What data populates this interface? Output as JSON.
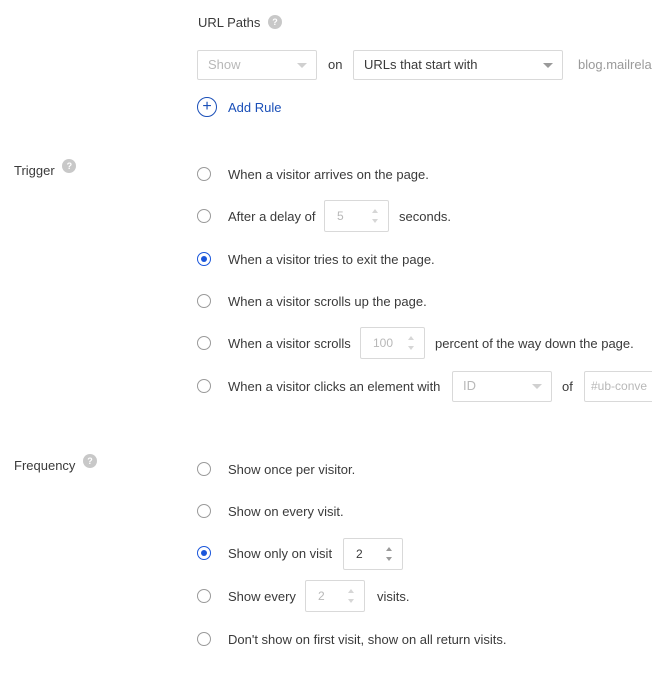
{
  "url_paths": {
    "title": "URL Paths",
    "help": "?",
    "show_select": "Show",
    "on_label": "on",
    "match_select": "URLs that start with",
    "url_value": "blog.mailrela",
    "add_rule": "Add Rule"
  },
  "trigger": {
    "title": "Trigger",
    "help": "?",
    "options": [
      {
        "label": "When a visitor arrives on the page."
      },
      {
        "label_before": "After a delay of",
        "value": "5",
        "label_after": "seconds."
      },
      {
        "label": "When a visitor tries to exit the page."
      },
      {
        "label": "When a visitor scrolls up the page."
      },
      {
        "label_before": "When a visitor scrolls",
        "value": "100",
        "label_after": "percent of the way down the page."
      },
      {
        "label_before": "When a visitor clicks an element with",
        "select": "ID",
        "of_label": "of",
        "placeholder": "#ub-conve"
      }
    ],
    "selected_index": 2
  },
  "frequency": {
    "title": "Frequency",
    "help": "?",
    "options": [
      {
        "label": "Show once per visitor."
      },
      {
        "label": "Show on every visit."
      },
      {
        "label_before": "Show only on visit",
        "value": "2"
      },
      {
        "label_before": "Show every",
        "value": "2",
        "label_after": "visits."
      },
      {
        "label": "Don't show on first visit, show on all return visits."
      }
    ],
    "selected_index": 2
  },
  "colors": {
    "accent": "#1a56db",
    "link": "#1a4fb8"
  }
}
